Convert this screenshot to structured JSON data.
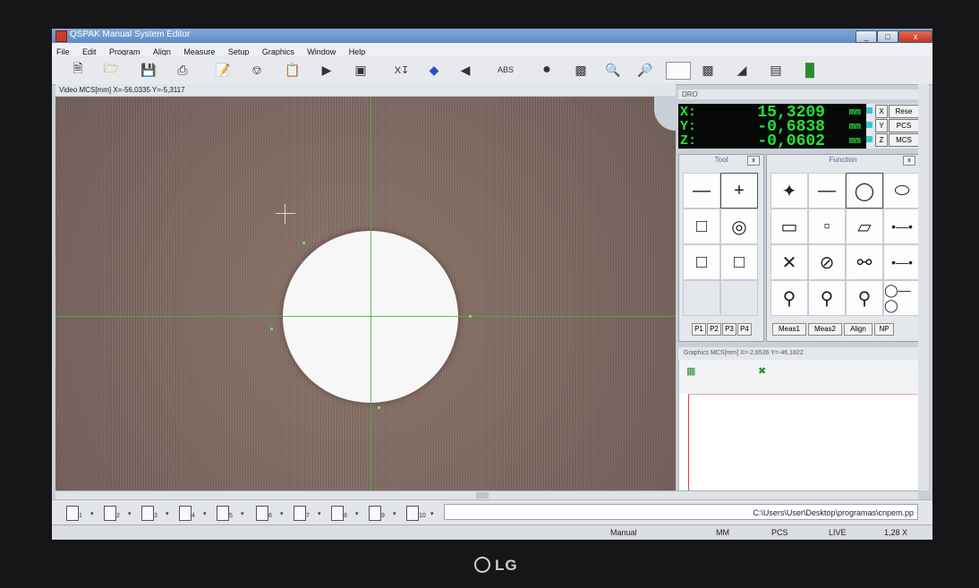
{
  "window": {
    "title": "QSPAK Manual System Editor",
    "controls": [
      "_",
      "□",
      "x"
    ]
  },
  "menu": [
    "File",
    "Edit",
    "Program",
    "Align",
    "Measure",
    "Setup",
    "Graphics",
    "Window",
    "Help"
  ],
  "toolbar": {
    "icons": [
      "new-file-icon",
      "open-folder-icon",
      "save-icon",
      "print-icon",
      "edit-program-icon",
      "probe-icon",
      "export-icon",
      "play-icon",
      "camera-target-icon",
      "text-tool-icon",
      "erase-icon",
      "speaker-icon",
      "abs-icon",
      "dot-icon",
      "zoom-fit-icon",
      "zoom-in-icon",
      "zoom-out-icon",
      "zoom-value-box",
      "view-icon",
      "light-icon",
      "report-icon",
      "chart-icon"
    ],
    "abs_label": "ABS"
  },
  "video": {
    "header": "Video  MCS[mm]  X=-56,0335  Y=-5,3117"
  },
  "dro": {
    "title": "DRO",
    "rows": [
      {
        "axis": "X:",
        "value": "15,3209",
        "unit": "mm",
        "axis_button": "X",
        "action": "Rese"
      },
      {
        "axis": "Y:",
        "value": "-0,6838",
        "unit": "mm",
        "axis_button": "Y",
        "action": "PCS"
      },
      {
        "axis": "Z:",
        "value": "-0,0602",
        "unit": "mm",
        "axis_button": "Z",
        "action": "MCS"
      }
    ],
    "value_color": "#27e03a"
  },
  "tool_panel": {
    "title": "Tool",
    "close": "x",
    "tabs": [
      "P1",
      "P2",
      "P3",
      "P4"
    ]
  },
  "function_panel": {
    "title": "Function",
    "close": "x",
    "tabs": [
      "Meas1",
      "Meas2",
      "Align",
      "NP"
    ]
  },
  "graphics": {
    "header": "Graphics  MCS[mm]  X=-2,6536  Y=-46,1822"
  },
  "bottom": {
    "pages": [
      "1",
      "2",
      "3",
      "4",
      "5",
      "6",
      "7",
      "8",
      "9",
      "10"
    ],
    "path": "C:\\Users\\User\\Desktop\\programas\\cnpem.pp"
  },
  "status": {
    "mode": "Manual",
    "units": "MM",
    "coord": "PCS",
    "video": "LIVE",
    "zoom": "1,28 X"
  },
  "monitor": {
    "brand": "LG"
  }
}
